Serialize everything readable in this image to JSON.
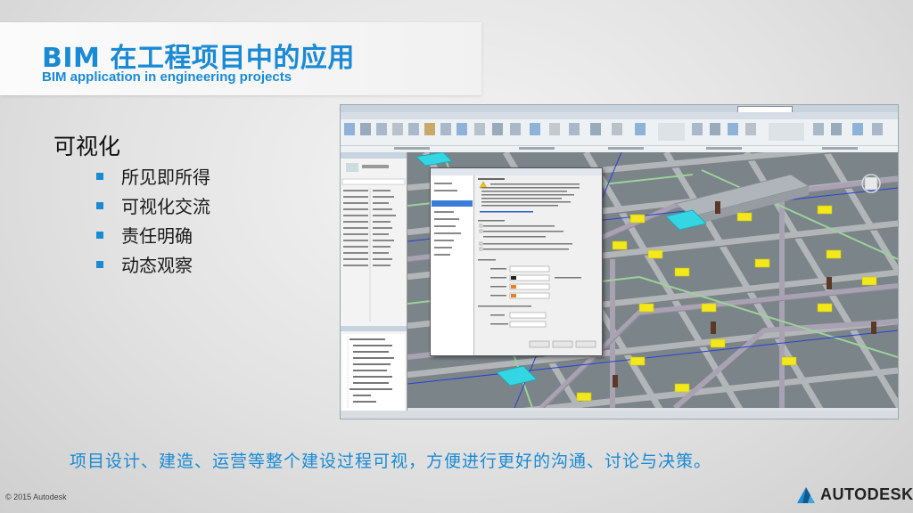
{
  "slide": {
    "title_cn": "BIM 在工程项目中的应用",
    "title_en": "BIM application in engineering projects",
    "section_heading": "可视化",
    "bullets": [
      "所见即所得",
      "可视化交流",
      "责任明确",
      "动态观察"
    ],
    "caption": "项目设计、建造、运营等整个建设过程可视，方便进行更好的沟通、讨论与决策。",
    "copyright": "© 2015 Autodesk",
    "logo_text": "AUTODESK"
  },
  "colors": {
    "accent": "#1a8ad4",
    "duct_cyan": "#35d6e4",
    "equipment_yellow": "#f2e81c",
    "structure_gray": "#b3b6b9",
    "pipe_gray": "#a8a2b2",
    "pipe_green": "#9bd29a"
  },
  "icons": [
    "autodesk-logo-icon",
    "bullet-square-icon"
  ]
}
